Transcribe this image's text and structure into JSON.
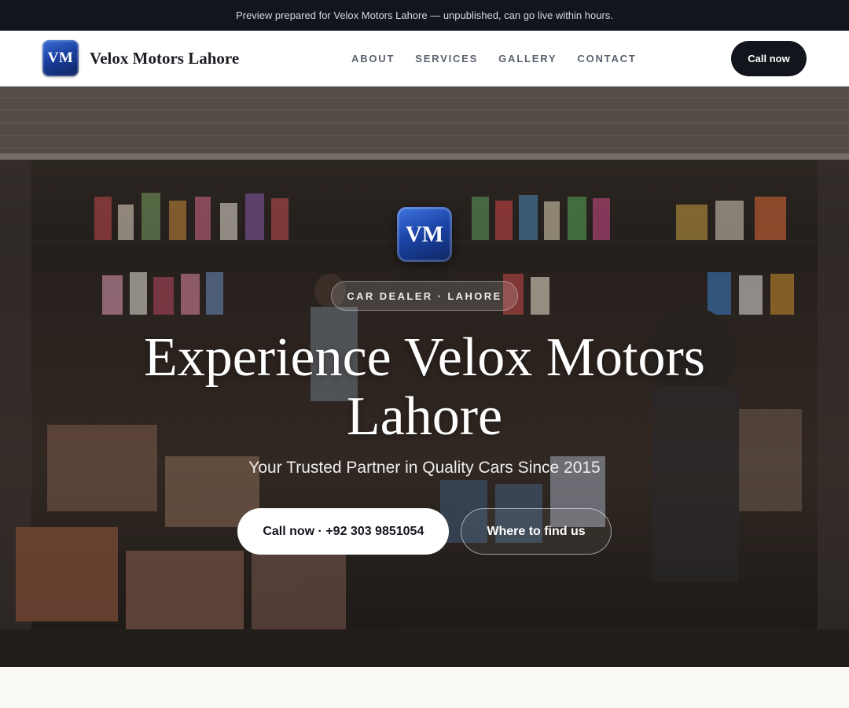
{
  "notice": {
    "text": "Preview prepared for Velox Motors Lahore — unpublished, can go live within hours."
  },
  "header": {
    "logo_text": "VM",
    "brand_name": "Velox Motors Lahore",
    "nav": [
      "ABOUT",
      "SERVICES",
      "GALLERY",
      "CONTACT"
    ],
    "cta_label": "Call now"
  },
  "hero": {
    "logo_text": "VM",
    "badge": "CAR DEALER · LAHORE",
    "headline": "Experience Velox Motors Lahore",
    "tagline": "Your Trusted Partner in Quality Cars Since 2015",
    "primary_button": "Call now · +92 303 9851054",
    "secondary_button": "Where to find us",
    "background_image": "shop-storefront-photo"
  },
  "colors": {
    "notice_bg": "#12151c",
    "dark": "#12151c",
    "logo_blue": "#1c45a8",
    "nav_text": "#5a6170",
    "page_bg": "#faf9f6"
  }
}
